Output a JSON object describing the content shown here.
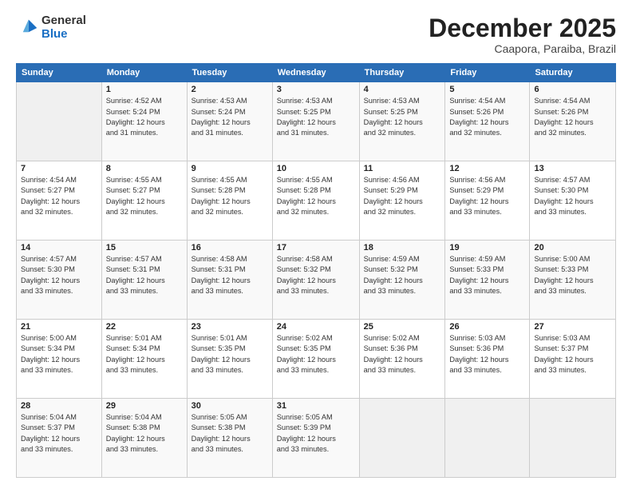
{
  "header": {
    "logo_general": "General",
    "logo_blue": "Blue",
    "month": "December 2025",
    "location": "Caapora, Paraiba, Brazil"
  },
  "weekdays": [
    "Sunday",
    "Monday",
    "Tuesday",
    "Wednesday",
    "Thursday",
    "Friday",
    "Saturday"
  ],
  "weeks": [
    [
      {
        "day": "",
        "info": ""
      },
      {
        "day": "1",
        "info": "Sunrise: 4:52 AM\nSunset: 5:24 PM\nDaylight: 12 hours\nand 31 minutes."
      },
      {
        "day": "2",
        "info": "Sunrise: 4:53 AM\nSunset: 5:24 PM\nDaylight: 12 hours\nand 31 minutes."
      },
      {
        "day": "3",
        "info": "Sunrise: 4:53 AM\nSunset: 5:25 PM\nDaylight: 12 hours\nand 31 minutes."
      },
      {
        "day": "4",
        "info": "Sunrise: 4:53 AM\nSunset: 5:25 PM\nDaylight: 12 hours\nand 32 minutes."
      },
      {
        "day": "5",
        "info": "Sunrise: 4:54 AM\nSunset: 5:26 PM\nDaylight: 12 hours\nand 32 minutes."
      },
      {
        "day": "6",
        "info": "Sunrise: 4:54 AM\nSunset: 5:26 PM\nDaylight: 12 hours\nand 32 minutes."
      }
    ],
    [
      {
        "day": "7",
        "info": "Sunrise: 4:54 AM\nSunset: 5:27 PM\nDaylight: 12 hours\nand 32 minutes."
      },
      {
        "day": "8",
        "info": "Sunrise: 4:55 AM\nSunset: 5:27 PM\nDaylight: 12 hours\nand 32 minutes."
      },
      {
        "day": "9",
        "info": "Sunrise: 4:55 AM\nSunset: 5:28 PM\nDaylight: 12 hours\nand 32 minutes."
      },
      {
        "day": "10",
        "info": "Sunrise: 4:55 AM\nSunset: 5:28 PM\nDaylight: 12 hours\nand 32 minutes."
      },
      {
        "day": "11",
        "info": "Sunrise: 4:56 AM\nSunset: 5:29 PM\nDaylight: 12 hours\nand 32 minutes."
      },
      {
        "day": "12",
        "info": "Sunrise: 4:56 AM\nSunset: 5:29 PM\nDaylight: 12 hours\nand 33 minutes."
      },
      {
        "day": "13",
        "info": "Sunrise: 4:57 AM\nSunset: 5:30 PM\nDaylight: 12 hours\nand 33 minutes."
      }
    ],
    [
      {
        "day": "14",
        "info": "Sunrise: 4:57 AM\nSunset: 5:30 PM\nDaylight: 12 hours\nand 33 minutes."
      },
      {
        "day": "15",
        "info": "Sunrise: 4:57 AM\nSunset: 5:31 PM\nDaylight: 12 hours\nand 33 minutes."
      },
      {
        "day": "16",
        "info": "Sunrise: 4:58 AM\nSunset: 5:31 PM\nDaylight: 12 hours\nand 33 minutes."
      },
      {
        "day": "17",
        "info": "Sunrise: 4:58 AM\nSunset: 5:32 PM\nDaylight: 12 hours\nand 33 minutes."
      },
      {
        "day": "18",
        "info": "Sunrise: 4:59 AM\nSunset: 5:32 PM\nDaylight: 12 hours\nand 33 minutes."
      },
      {
        "day": "19",
        "info": "Sunrise: 4:59 AM\nSunset: 5:33 PM\nDaylight: 12 hours\nand 33 minutes."
      },
      {
        "day": "20",
        "info": "Sunrise: 5:00 AM\nSunset: 5:33 PM\nDaylight: 12 hours\nand 33 minutes."
      }
    ],
    [
      {
        "day": "21",
        "info": "Sunrise: 5:00 AM\nSunset: 5:34 PM\nDaylight: 12 hours\nand 33 minutes."
      },
      {
        "day": "22",
        "info": "Sunrise: 5:01 AM\nSunset: 5:34 PM\nDaylight: 12 hours\nand 33 minutes."
      },
      {
        "day": "23",
        "info": "Sunrise: 5:01 AM\nSunset: 5:35 PM\nDaylight: 12 hours\nand 33 minutes."
      },
      {
        "day": "24",
        "info": "Sunrise: 5:02 AM\nSunset: 5:35 PM\nDaylight: 12 hours\nand 33 minutes."
      },
      {
        "day": "25",
        "info": "Sunrise: 5:02 AM\nSunset: 5:36 PM\nDaylight: 12 hours\nand 33 minutes."
      },
      {
        "day": "26",
        "info": "Sunrise: 5:03 AM\nSunset: 5:36 PM\nDaylight: 12 hours\nand 33 minutes."
      },
      {
        "day": "27",
        "info": "Sunrise: 5:03 AM\nSunset: 5:37 PM\nDaylight: 12 hours\nand 33 minutes."
      }
    ],
    [
      {
        "day": "28",
        "info": "Sunrise: 5:04 AM\nSunset: 5:37 PM\nDaylight: 12 hours\nand 33 minutes."
      },
      {
        "day": "29",
        "info": "Sunrise: 5:04 AM\nSunset: 5:38 PM\nDaylight: 12 hours\nand 33 minutes."
      },
      {
        "day": "30",
        "info": "Sunrise: 5:05 AM\nSunset: 5:38 PM\nDaylight: 12 hours\nand 33 minutes."
      },
      {
        "day": "31",
        "info": "Sunrise: 5:05 AM\nSunset: 5:39 PM\nDaylight: 12 hours\nand 33 minutes."
      },
      {
        "day": "",
        "info": ""
      },
      {
        "day": "",
        "info": ""
      },
      {
        "day": "",
        "info": ""
      }
    ]
  ]
}
